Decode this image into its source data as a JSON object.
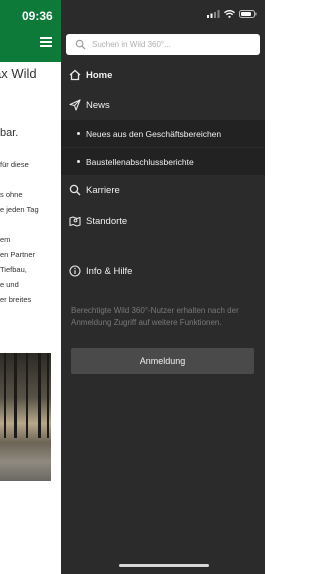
{
  "status_bar": {
    "time": "09:36"
  },
  "background_page": {
    "title_fragment": "ax Wild",
    "headline_fragment": "bar.",
    "text_lines": [
      "für diese",
      "s ohne",
      "e jeden Tag",
      "em",
      "en Partner",
      "Tiefbau,",
      "e und",
      "er breites"
    ]
  },
  "drawer": {
    "search": {
      "placeholder": "Suchen in Wild 360°..."
    },
    "nav": {
      "home": {
        "label": "Home",
        "icon": "home-icon"
      },
      "news": {
        "label": "News",
        "icon": "paper-plane-icon"
      },
      "news_sub": [
        {
          "label": "Neues aus den Geschäftsbereichen"
        },
        {
          "label": "Baustellenabschlussberichte"
        }
      ],
      "karriere": {
        "label": "Karriere",
        "icon": "search-icon"
      },
      "standorte": {
        "label": "Standorte",
        "icon": "map-icon"
      },
      "info": {
        "label": "Info & Hilfe",
        "icon": "info-icon"
      }
    },
    "info_text": "Berechtigte Wild 360°-Nutzer erhalten nach der Anmeldung Zugriff auf weitere Funktionen.",
    "login_button": "Anmeldung"
  },
  "colors": {
    "header_green": "#0e7a3a",
    "drawer_bg": "#2b2b2b",
    "sub_bg": "#222222"
  }
}
